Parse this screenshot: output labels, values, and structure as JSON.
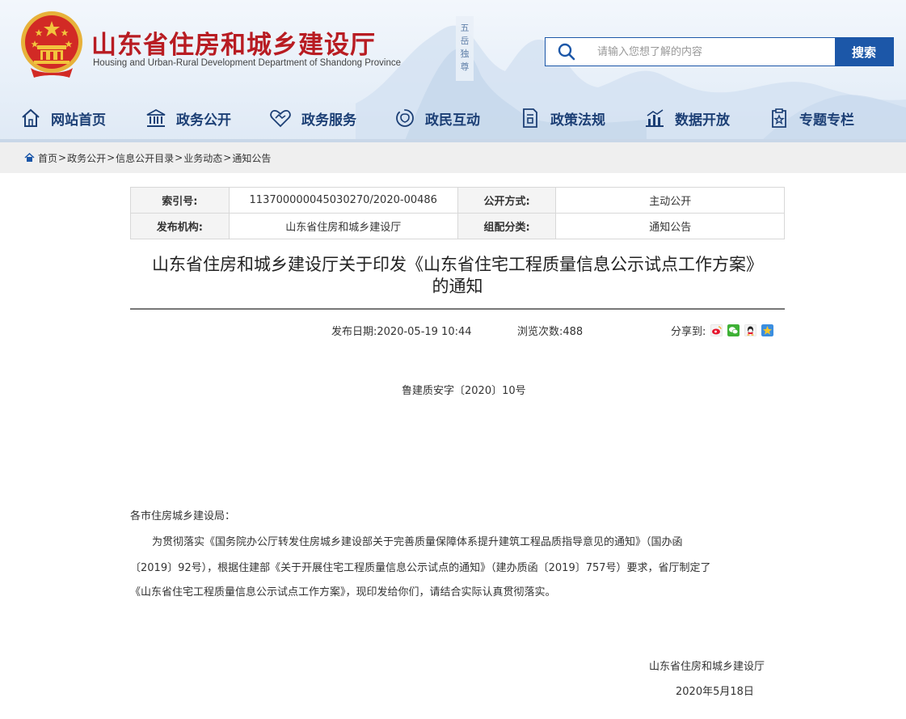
{
  "header": {
    "title_cn": "山东省住房和城乡建设厅",
    "title_en": "Housing and Urban-Rural Development Department of Shandong Province",
    "search": {
      "placeholder": "请输入您想了解的内容",
      "button": "搜索"
    },
    "colors": {
      "brand_red": "#b81c22",
      "brand_blue": "#1c57a8",
      "nav_text": "#1c3f75"
    }
  },
  "nav": {
    "items": [
      {
        "label": "网站首页",
        "icon": "home-icon"
      },
      {
        "label": "政务公开",
        "icon": "government-building-icon"
      },
      {
        "label": "政务服务",
        "icon": "handshake-heart-icon"
      },
      {
        "label": "政民互动",
        "icon": "interaction-icon"
      },
      {
        "label": "政策法规",
        "icon": "document-policy-icon"
      },
      {
        "label": "数据开放",
        "icon": "bar-chart-icon"
      },
      {
        "label": "专题专栏",
        "icon": "star-clipboard-icon"
      }
    ]
  },
  "breadcrumb": {
    "items": [
      "首页",
      "政务公开",
      "信息公开目录",
      "业务动态",
      "通知公告"
    ],
    "separator": ">"
  },
  "meta": {
    "index_label": "索引号:",
    "index_value": "113700000045030270/2020-00486",
    "open_label": "公开方式:",
    "open_value": "主动公开",
    "publisher_label": "发布机构:",
    "publisher_value": "山东省住房和城乡建设厅",
    "category_label": "组配分类:",
    "category_value": "通知公告"
  },
  "article": {
    "title_line1": "山东省住房和城乡建设厅关于印发《山东省住宅工程质量信息公示试点工作方案》",
    "title_line2": "的通知",
    "publish_date": "发布日期:2020-05-19 10:44",
    "views": "浏览次数:488",
    "share_label": "分享到:",
    "share_icons": [
      "weibo-icon",
      "wechat-icon",
      "qq-icon",
      "qzone-icon"
    ],
    "doc_number": "鲁建质安字〔2020〕10号",
    "addressee": "各市住房城乡建设局：",
    "body_line1": "为贯彻落实《国务院办公厅转发住房城乡建设部关于完善质量保障体系提升建筑工程品质指导意见的通知》（国办函",
    "body_line2": "〔2019〕92号），根据住建部《关于开展住宅工程质量信息公示试点的通知》（建办质函〔2019〕757号）要求，省厅制定了",
    "body_line3": "《山东省住宅工程质量信息公示试点工作方案》，现印发给你们，请结合实际认真贯彻落实。",
    "signature_org": "山东省住房和城乡建设厅",
    "signature_date": "2020年5月18日"
  }
}
